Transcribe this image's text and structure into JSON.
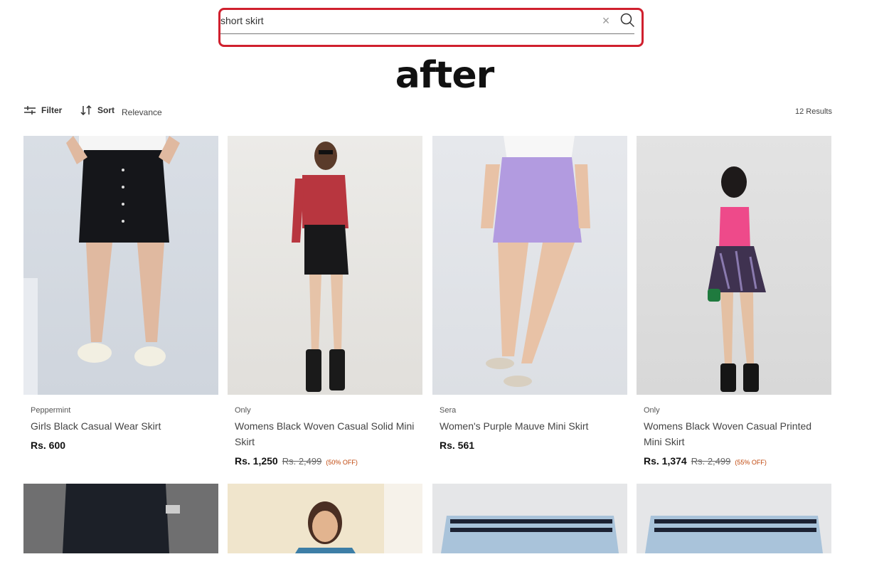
{
  "search": {
    "value": "short skirt",
    "placeholder": ""
  },
  "annotation": "after",
  "toolbar": {
    "filter_label": "Filter",
    "sort_label": "Sort",
    "sort_value": "Relevance",
    "results": "12 Results"
  },
  "products": [
    {
      "brand": "Peppermint",
      "name": "Girls Black Casual Wear Skirt",
      "price": "Rs. 600",
      "mrp": "",
      "discount": ""
    },
    {
      "brand": "Only",
      "name": "Womens Black Woven Casual Solid Mini Skirt",
      "price": "Rs. 1,250",
      "mrp": "Rs. 2,499",
      "discount": "(50% OFF)"
    },
    {
      "brand": "Sera",
      "name": "Women's Purple Mauve Mini Skirt",
      "price": "Rs. 561",
      "mrp": "",
      "discount": ""
    },
    {
      "brand": "Only",
      "name": "Womens Black Woven Casual Printed Mini Skirt",
      "price": "Rs. 1,374",
      "mrp": "Rs. 2,499",
      "discount": "(55% OFF)"
    }
  ],
  "colors": {
    "highlight": "#d0202e",
    "discount": "#c0470c"
  }
}
